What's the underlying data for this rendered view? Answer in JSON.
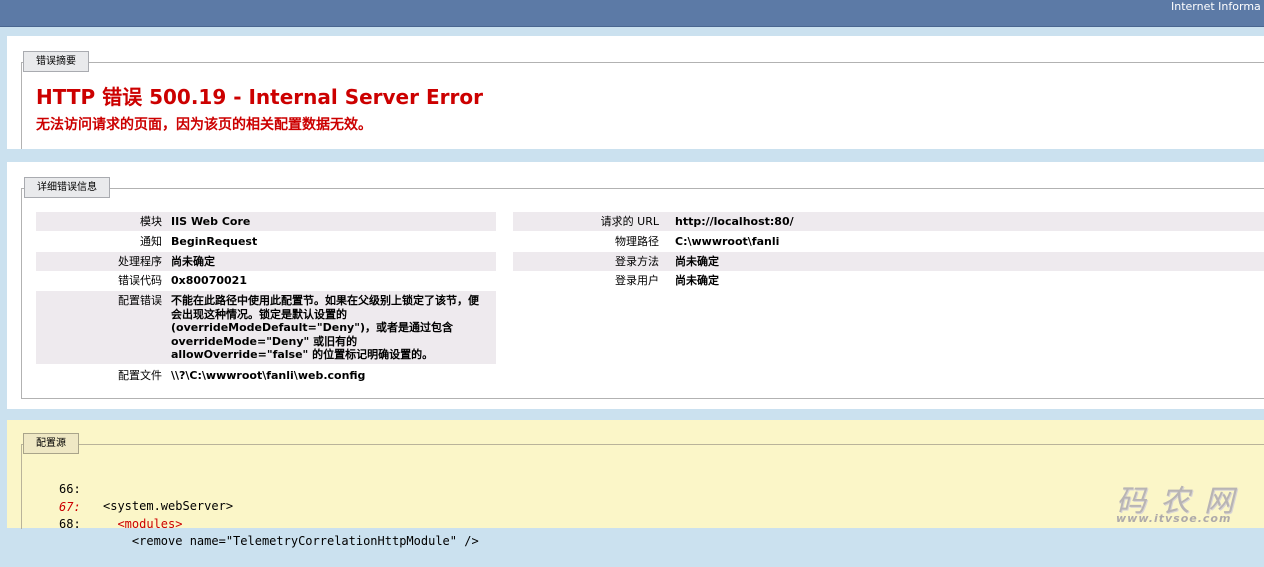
{
  "header": {
    "title": "Internet Informa"
  },
  "summary": {
    "legend": "错误摘要",
    "title": "HTTP 错误 500.19 - Internal Server Error",
    "description": "无法访问请求的页面，因为该页的相关配置数据无效。"
  },
  "detail": {
    "legend": "详细错误信息",
    "left": [
      {
        "label": "模块",
        "value": "IIS Web Core"
      },
      {
        "label": "通知",
        "value": "BeginRequest"
      },
      {
        "label": "处理程序",
        "value": "尚未确定"
      },
      {
        "label": "错误代码",
        "value": "0x80070021"
      },
      {
        "label": "配置错误",
        "value": "不能在此路径中使用此配置节。如果在父级别上锁定了该节，便会出现这种情况。锁定是默认设置的(overrideModeDefault=\"Deny\")，或者是通过包含 overrideMode=\"Deny\" 或旧有的 allowOverride=\"false\" 的位置标记明确设置的。"
      },
      {
        "label": "配置文件",
        "value": "\\\\?\\C:\\wwwroot\\fanli\\web.config"
      }
    ],
    "right": [
      {
        "label": "请求的 URL",
        "value": "http://localhost:80/"
      },
      {
        "label": "物理路径",
        "value": "C:\\wwwroot\\fanli"
      },
      {
        "label": "登录方法",
        "value": "尚未确定"
      },
      {
        "label": "登录用户",
        "value": "尚未确定"
      }
    ]
  },
  "config_source": {
    "legend": "配置源",
    "lines": [
      {
        "num": "66:",
        "text": "<system.webServer>"
      },
      {
        "num": "67:",
        "text": "  <modules>"
      },
      {
        "num": "68:",
        "text": "    <remove name=\"TelemetryCorrelationHttpModule\" />"
      }
    ]
  },
  "watermark": {
    "brand": "码农网",
    "url": "www.itvsoe.com"
  }
}
